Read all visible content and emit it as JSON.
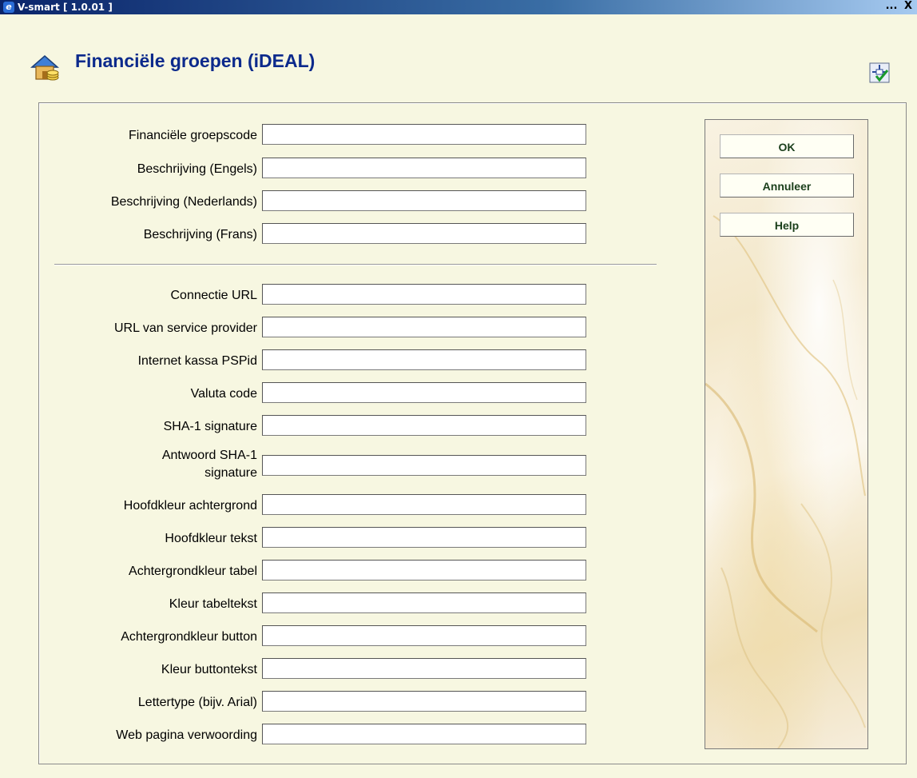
{
  "window": {
    "title": "V-smart [ 1.0.01 ]",
    "controls": [
      "...",
      "X"
    ]
  },
  "header": {
    "title": "Financiële groepen (iDEAL)",
    "page_icon": "house-coins-icon",
    "tool_icon": "settings-check-icon"
  },
  "form": {
    "fields": [
      {
        "label": "Financiële groepscode",
        "value": ""
      },
      {
        "label": "Beschrijving (Engels)",
        "value": ""
      },
      {
        "label": "Beschrijving (Nederlands)",
        "value": ""
      },
      {
        "label": "Beschrijving (Frans)",
        "value": ""
      },
      {
        "label": "Connectie URL",
        "value": ""
      },
      {
        "label": "URL van service provider",
        "value": ""
      },
      {
        "label": "Internet kassa PSPid",
        "value": ""
      },
      {
        "label": "Valuta code",
        "value": ""
      },
      {
        "label": "SHA-1 signature",
        "value": ""
      },
      {
        "label_line1": "Antwoord SHA-1",
        "label_line2": "signature",
        "value": ""
      },
      {
        "label": "Hoofdkleur achtergrond",
        "value": ""
      },
      {
        "label": "Hoofdkleur tekst",
        "value": ""
      },
      {
        "label": "Achtergrondkleur tabel",
        "value": ""
      },
      {
        "label": "Kleur tabeltekst",
        "value": ""
      },
      {
        "label": "Achtergrondkleur button",
        "value": ""
      },
      {
        "label": "Kleur buttontekst",
        "value": ""
      },
      {
        "label": "Lettertype (bijv. Arial)",
        "value": ""
      },
      {
        "label": "Web pagina verwoording",
        "value": ""
      }
    ]
  },
  "buttons": {
    "ok": "OK",
    "cancel": "Annuleer",
    "help": "Help"
  },
  "colors": {
    "background": "#f7f7e1",
    "title": "#0c2a8c",
    "button_text": "#1a3e1a"
  }
}
